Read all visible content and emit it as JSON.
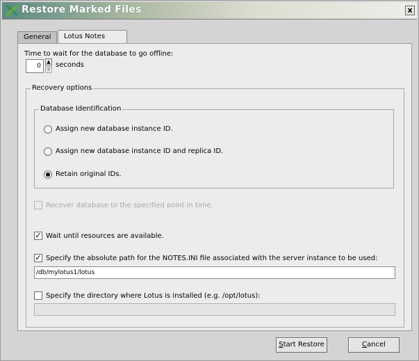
{
  "window": {
    "title": "Restore Marked Files",
    "close_glyph": "x"
  },
  "tabs": [
    {
      "label": "General",
      "active": false
    },
    {
      "label": "Lotus Notes",
      "active": true
    }
  ],
  "wait": {
    "label": "Time to wait for the database to go offline:",
    "value": "0",
    "unit": "seconds"
  },
  "recovery": {
    "group_title": "Recovery options",
    "db_ident": {
      "group_title": "Database Identification",
      "options": [
        {
          "label": "Assign new database instance ID.",
          "selected": false
        },
        {
          "label": "Assign new database instance ID and replica ID.",
          "selected": false
        },
        {
          "label": "Retain original IDs.",
          "selected": true
        }
      ]
    },
    "point_in_time": {
      "label": "Recover database to the specified point in time.",
      "checked": false,
      "enabled": false
    },
    "wait_resources": {
      "label": "Wait until resources are available.",
      "checked": true
    },
    "notes_ini": {
      "label": "Specify the absolute path for the NOTES.INI file associated with the server instance to be used:",
      "checked": true,
      "value": "/db/mylotus1/lotus"
    },
    "lotus_dir": {
      "label": "Specify the directory where Lotus is installed (e.g. /opt/lotus):",
      "checked": false,
      "value": ""
    }
  },
  "buttons": {
    "start_prefix": "S",
    "start_rest": "tart Restore",
    "cancel_prefix": "C",
    "cancel_rest": "ancel"
  },
  "colors": {
    "title_start": "#5a8a82",
    "panel_bg": "#ececec",
    "window_bg": "#d4d4d4"
  },
  "icons": {
    "app": "x-logo-icon",
    "close": "close-icon"
  }
}
